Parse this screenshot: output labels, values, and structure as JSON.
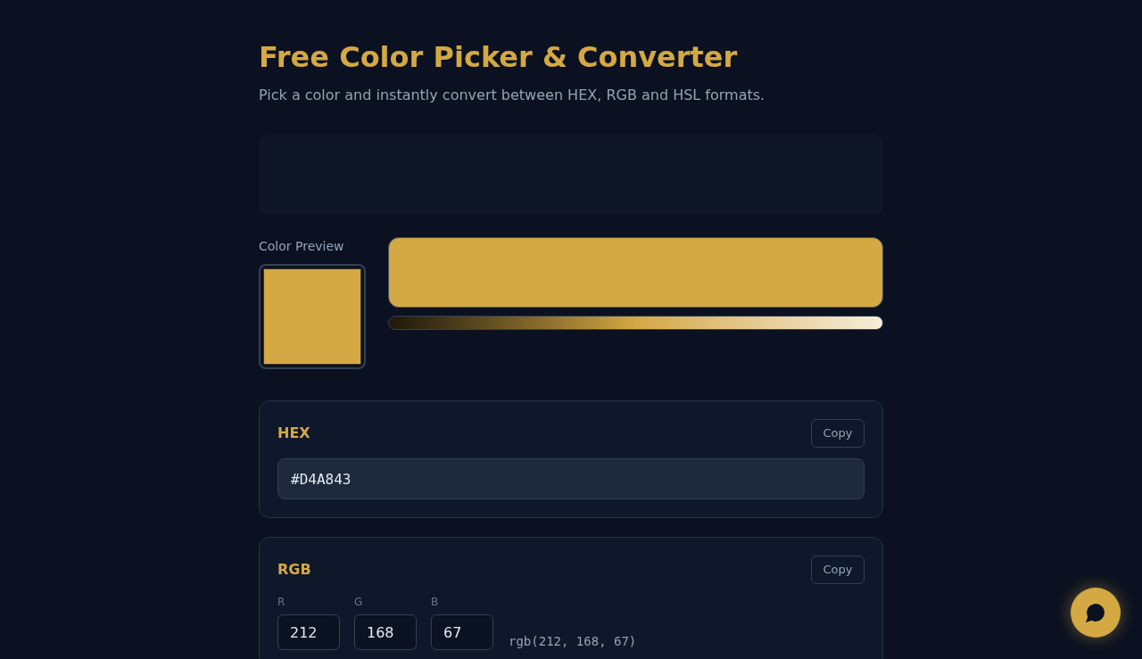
{
  "title": "Free Color Picker & Converter",
  "subtitle": "Pick a color and instantly convert between HEX, RGB and HSL formats.",
  "preview": {
    "label": "Color Preview",
    "color": "#d4a843"
  },
  "formats": [
    {
      "kind": "hex",
      "name": "HEX",
      "copy_label": "Copy",
      "value": "#D4A843"
    },
    {
      "kind": "rgb",
      "name": "RGB",
      "copy_label": "Copy",
      "channels": [
        {
          "label": "R",
          "value": "212"
        },
        {
          "label": "G",
          "value": "168"
        },
        {
          "label": "B",
          "value": "67"
        }
      ],
      "css": "rgb(212, 168, 67)"
    }
  ]
}
